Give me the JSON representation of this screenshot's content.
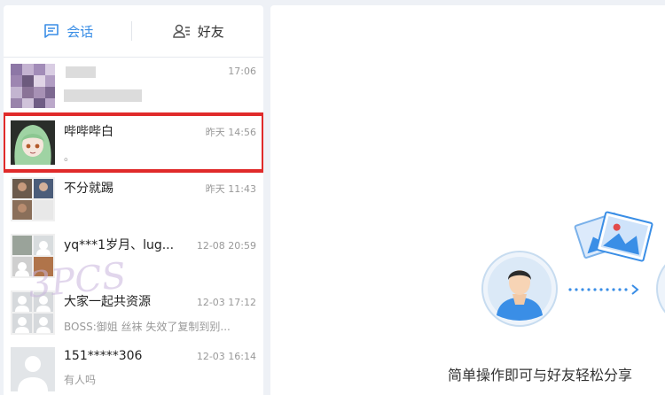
{
  "tabs": [
    {
      "label": "会话",
      "icon": "chat-icon",
      "active": true
    },
    {
      "label": "好友",
      "icon": "friends-icon",
      "active": false
    }
  ],
  "conversations": [
    {
      "name": "",
      "time": "17:06",
      "preview": ""
    },
    {
      "name": "哔哔哔白",
      "time": "昨天 14:56",
      "preview": "。"
    },
    {
      "name": "不分就踢",
      "time": "昨天 11:43",
      "preview": ""
    },
    {
      "name": "yq***1岁月、lug...",
      "time": "12-08 20:59",
      "preview": ""
    },
    {
      "name": "大家一起共资源",
      "time": "12-03 17:12",
      "preview": "BOSS:御姐 丝袜 失效了复制到别..."
    },
    {
      "name": "151*****306",
      "time": "12-03 16:14",
      "preview": "有人吗"
    }
  ],
  "empty_state": {
    "caption": "简单操作即可与好友轻松分享"
  },
  "watermark": "3PCS",
  "colors": {
    "accent": "#3a8ee6",
    "highlight": "#e02a2a"
  }
}
